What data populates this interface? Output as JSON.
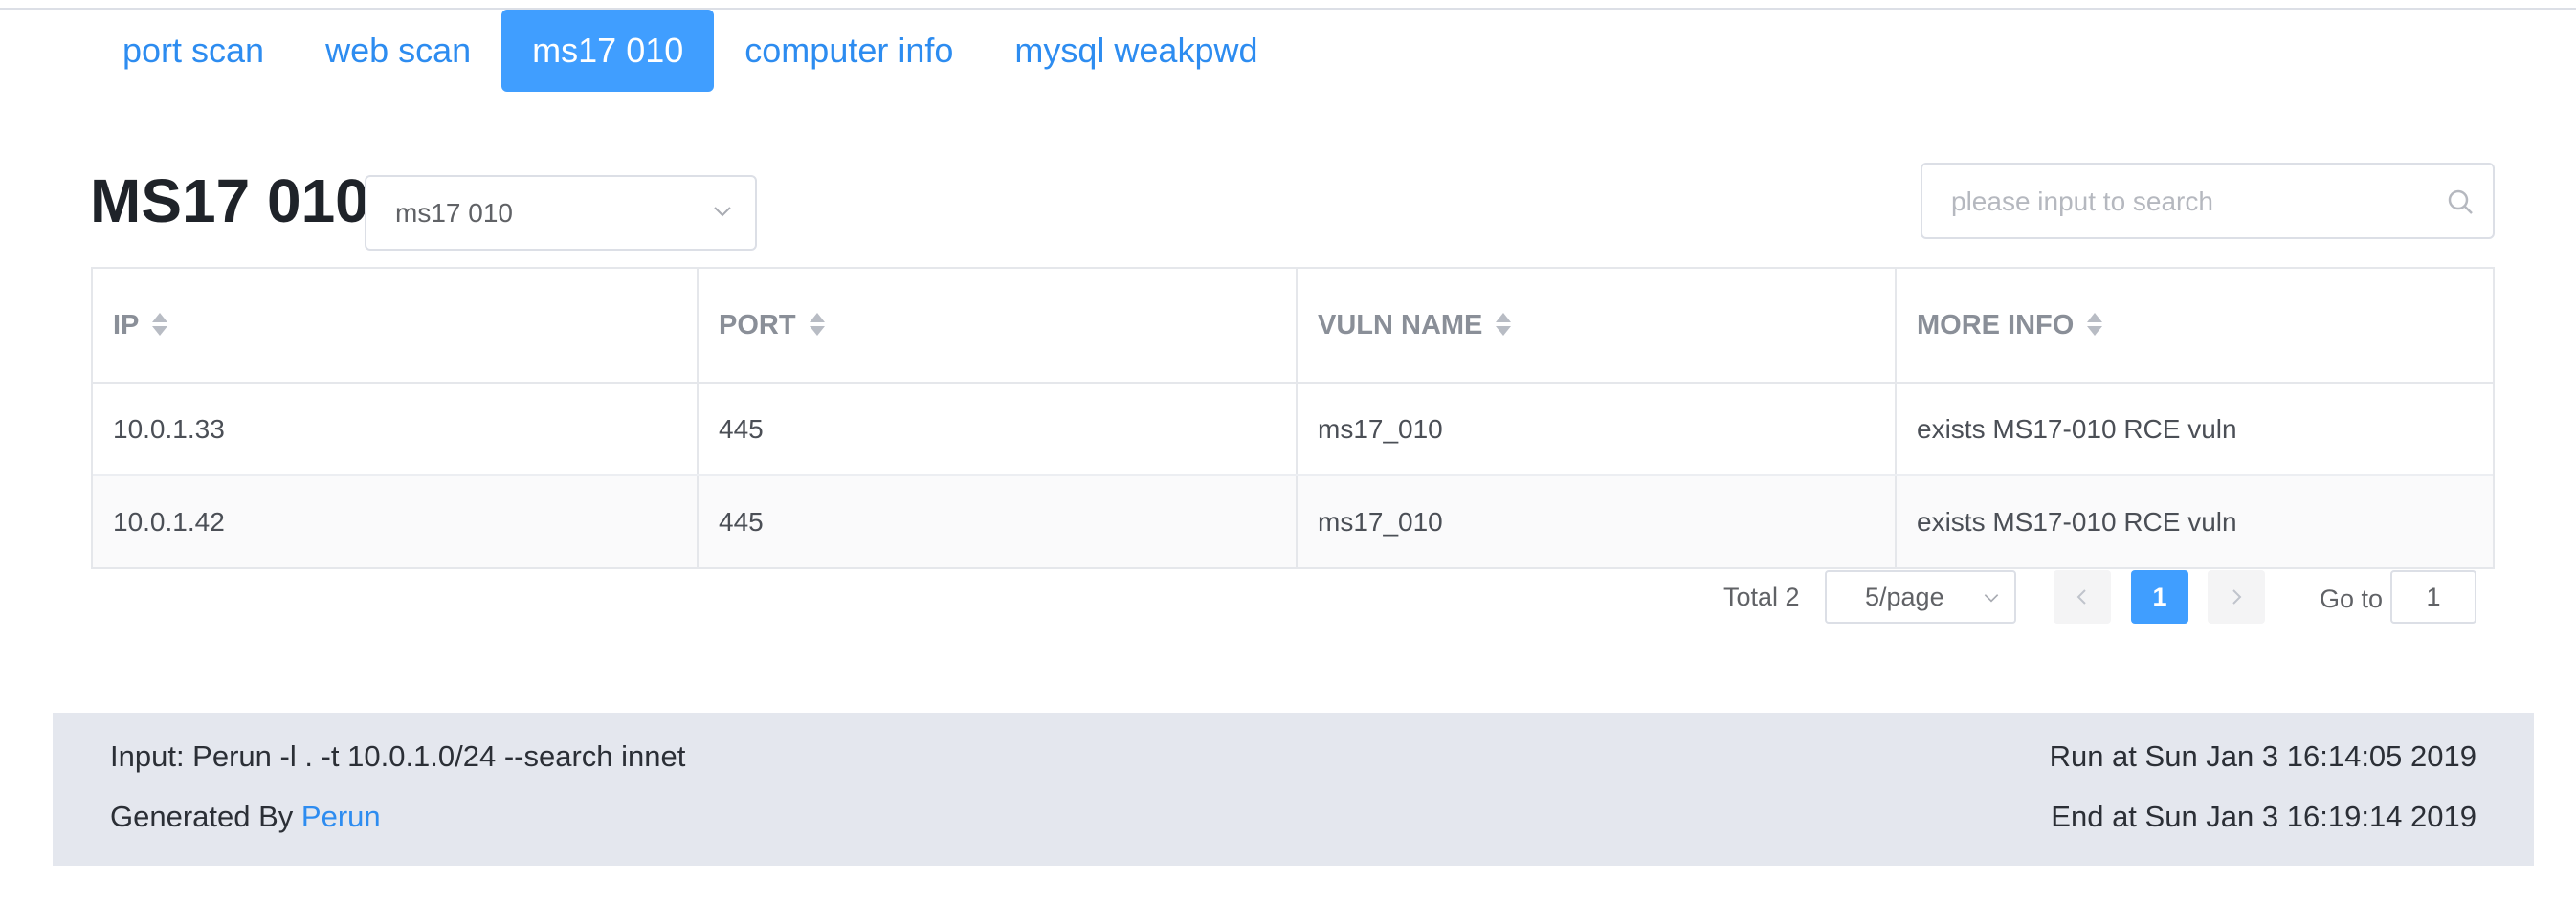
{
  "tabs": [
    {
      "label": "port scan",
      "active": false
    },
    {
      "label": "web scan",
      "active": false
    },
    {
      "label": "ms17 010",
      "active": true
    },
    {
      "label": "computer info",
      "active": false
    },
    {
      "label": "mysql weakpwd",
      "active": false
    }
  ],
  "section": {
    "title": "MS17 010",
    "select_value": "ms17 010"
  },
  "search": {
    "placeholder": "please input to search"
  },
  "table": {
    "columns": [
      "IP",
      "PORT",
      "VULN NAME",
      "MORE INFO"
    ],
    "rows": [
      [
        "10.0.1.33",
        "445",
        "ms17_010",
        "exists MS17-010 RCE vuln"
      ],
      [
        "10.0.1.42",
        "445",
        "ms17_010",
        "exists MS17-010 RCE vuln"
      ]
    ]
  },
  "pagination": {
    "total": "Total 2",
    "page_size": "5/page",
    "current_page": "1",
    "goto_label": "Go to",
    "goto_value": "1"
  },
  "footer": {
    "input": "Input: Perun -l . -t 10.0.1.0/24 --search innet",
    "generated_prefix": "Generated By ",
    "generated_link": "Perun",
    "run_at": "Run at Sun Jan 3 16:14:05 2019",
    "end_at": "End at Sun Jan 3 16:19:14 2019"
  },
  "colors": {
    "accent": "#409eff",
    "link": "#2d8cf0",
    "footer_bg": "#e4e7ee"
  }
}
